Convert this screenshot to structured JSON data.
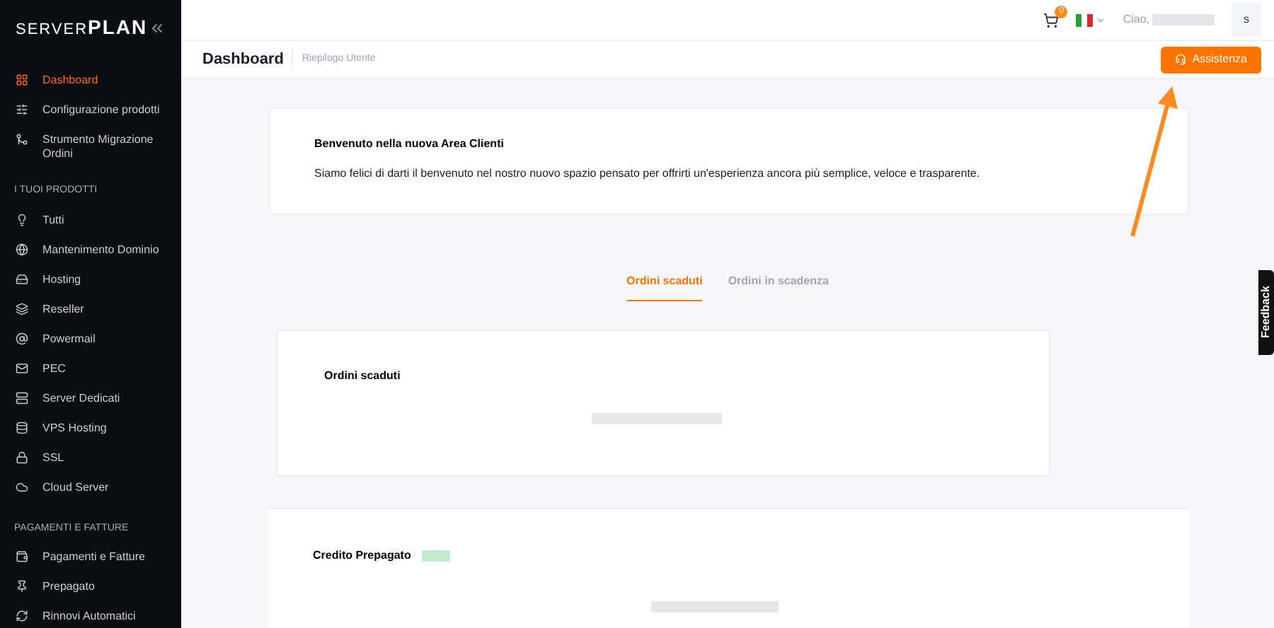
{
  "sidebar": {
    "logo": "SERVER**PLAN**",
    "groups": [
      {
        "items": [
          {
            "label": "Dashboard",
            "selected": true
          },
          {
            "label": "Configurazione prodotti",
            "selected": false
          },
          {
            "label": "Strumento Migrazione Ordini",
            "selected": false
          }
        ]
      },
      {
        "title": "I TUOI PRODOTTI",
        "items": [
          {
            "label": "Tutti",
            "selected": false
          },
          {
            "label": "Mantenimento Dominio",
            "selected": false
          },
          {
            "label": "Hosting",
            "selected": false
          },
          {
            "label": "Reseller",
            "selected": false
          },
          {
            "label": "Powermail",
            "selected": false
          },
          {
            "label": "PEC",
            "selected": false
          },
          {
            "label": "Server Dedicati",
            "selected": false
          },
          {
            "label": "VPS Hosting",
            "selected": false
          },
          {
            "label": "SSL",
            "selected": false
          },
          {
            "label": "Cloud Server",
            "selected": false
          }
        ]
      },
      {
        "title": "PAGAMENTI E FATTURE",
        "items": [
          {
            "label": "Pagamenti e Fatture",
            "selected": false
          },
          {
            "label": "Prepagato",
            "selected": false
          },
          {
            "label": "Rinnovi Automatici",
            "selected": false
          }
        ]
      }
    ]
  },
  "topbar": {
    "cart_count": "0",
    "greeting": "Ciao,",
    "avatar": "s"
  },
  "header": {
    "title": "Dashboard",
    "subtitle": "Riepilogo Utente",
    "button": "Assistenza"
  },
  "welcome": {
    "title": "Benvenuto nella nuova Area Clienti",
    "text": "Siamo felici di darti il benvenuto nel nostro nuovo spazio pensato per offrirti un'esperienza ancora più semplice, veloce e trasparente."
  },
  "tabs": [
    {
      "label": "Ordini scaduti",
      "selected": true
    },
    {
      "label": "Ordini in scadenza",
      "selected": false
    }
  ],
  "orders_card": {
    "title": "Ordini scaduti"
  },
  "credit_card": {
    "title": "Credito Prepagato"
  },
  "feedback": "Feedback"
}
